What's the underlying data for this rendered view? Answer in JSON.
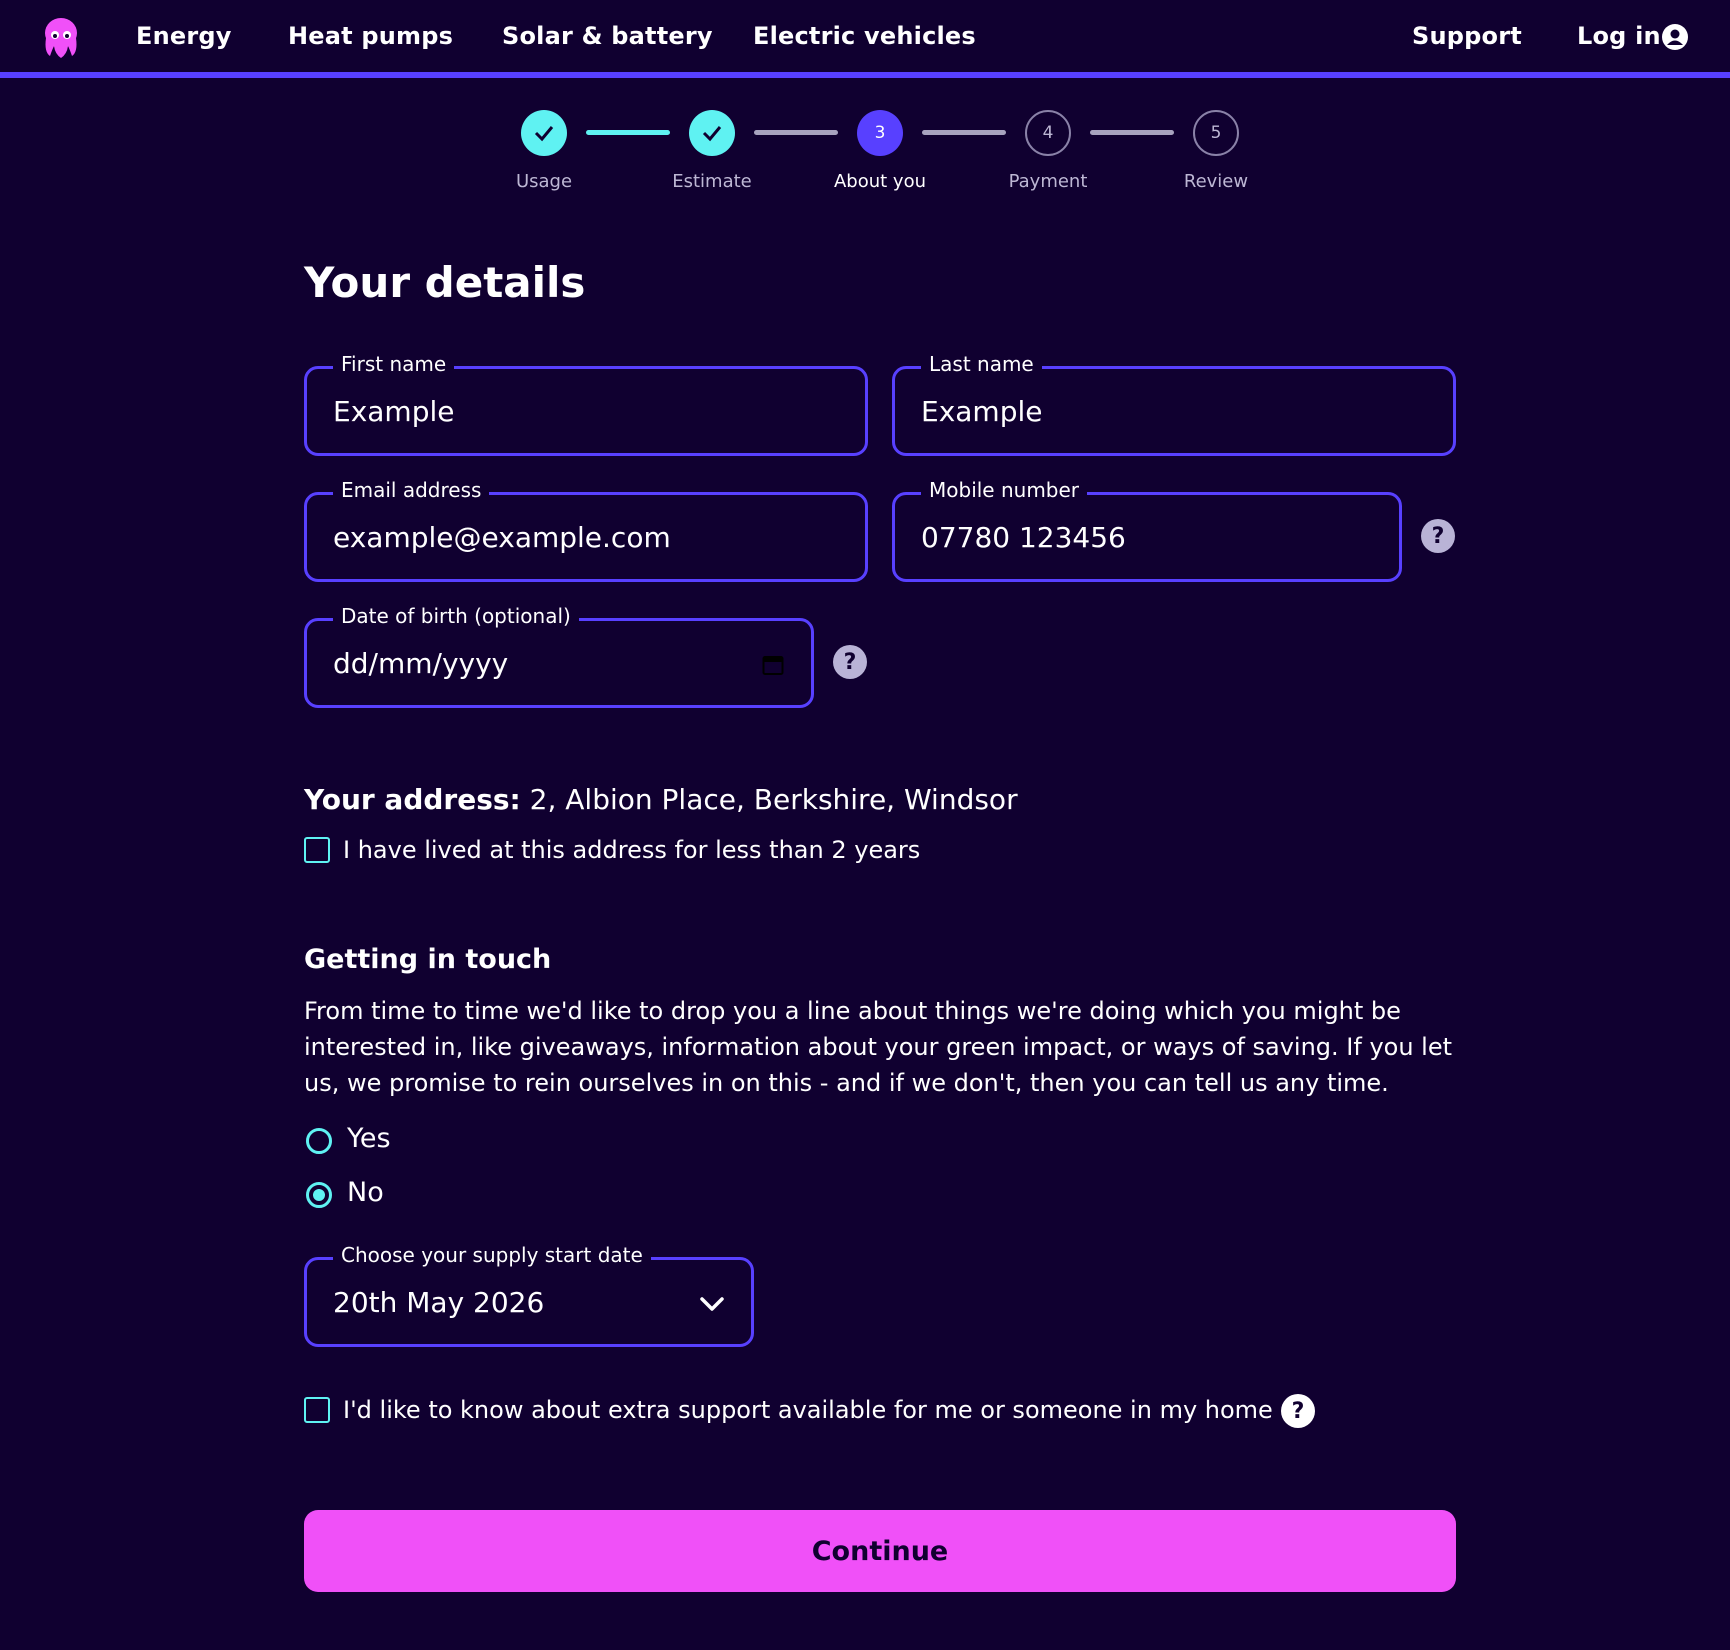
{
  "nav": {
    "links": [
      "Energy",
      "Heat pumps",
      "Solar & battery",
      "Electric vehicles"
    ],
    "support": "Support",
    "login": "Log in"
  },
  "stepper": {
    "steps": [
      {
        "number": "1",
        "label": "Usage",
        "state": "done"
      },
      {
        "number": "2",
        "label": "Estimate",
        "state": "done"
      },
      {
        "number": "3",
        "label": "About you",
        "state": "current"
      },
      {
        "number": "4",
        "label": "Payment",
        "state": "todo"
      },
      {
        "number": "5",
        "label": "Review",
        "state": "todo"
      }
    ]
  },
  "form": {
    "title": "Your details",
    "first_name": {
      "label": "First name",
      "value": "Example"
    },
    "last_name": {
      "label": "Last name",
      "value": "Example"
    },
    "email": {
      "label": "Email address",
      "value": "example@example.com"
    },
    "mobile": {
      "label": "Mobile number",
      "value": "07780 123456"
    },
    "dob": {
      "label": "Date of birth (optional)",
      "placeholder": "dd/mm/yyyy"
    },
    "address_label": "Your address:",
    "address_value": "2, Albion Place, Berkshire, Windsor",
    "lived_less_than_2_years": {
      "label": "I have lived at this address for less than 2 years",
      "checked": false
    },
    "contact_heading": "Getting in touch",
    "contact_text": "From time to time we'd like to drop you a line about things we're doing which you might be interested in, like giveaways, information about your green impact, or ways of saving. If you let us, we promise to rein ourselves in on this - and if we don't, then you can tell us any time.",
    "contact_options": [
      {
        "label": "Yes",
        "selected": false
      },
      {
        "label": "No",
        "selected": true
      }
    ],
    "supply_start": {
      "label": "Choose your supply start date",
      "value": "20th May 2026"
    },
    "extra_support": {
      "label": "I'd like to know about extra support available for me or someone in my home",
      "checked": false
    },
    "continue_label": "Continue",
    "help_glyph": "?"
  },
  "colors": {
    "background": "#100030",
    "accent_purple": "#5840ff",
    "accent_cyan": "#5ff2f2",
    "button_pink": "#f050f8",
    "logo_pink": "#f050f8"
  },
  "icons": {
    "logo": "octopus-logo-icon",
    "user": "user-icon",
    "check": "check-icon",
    "help": "help-icon",
    "calendar": "calendar-icon",
    "chevron": "chevron-down-icon"
  }
}
